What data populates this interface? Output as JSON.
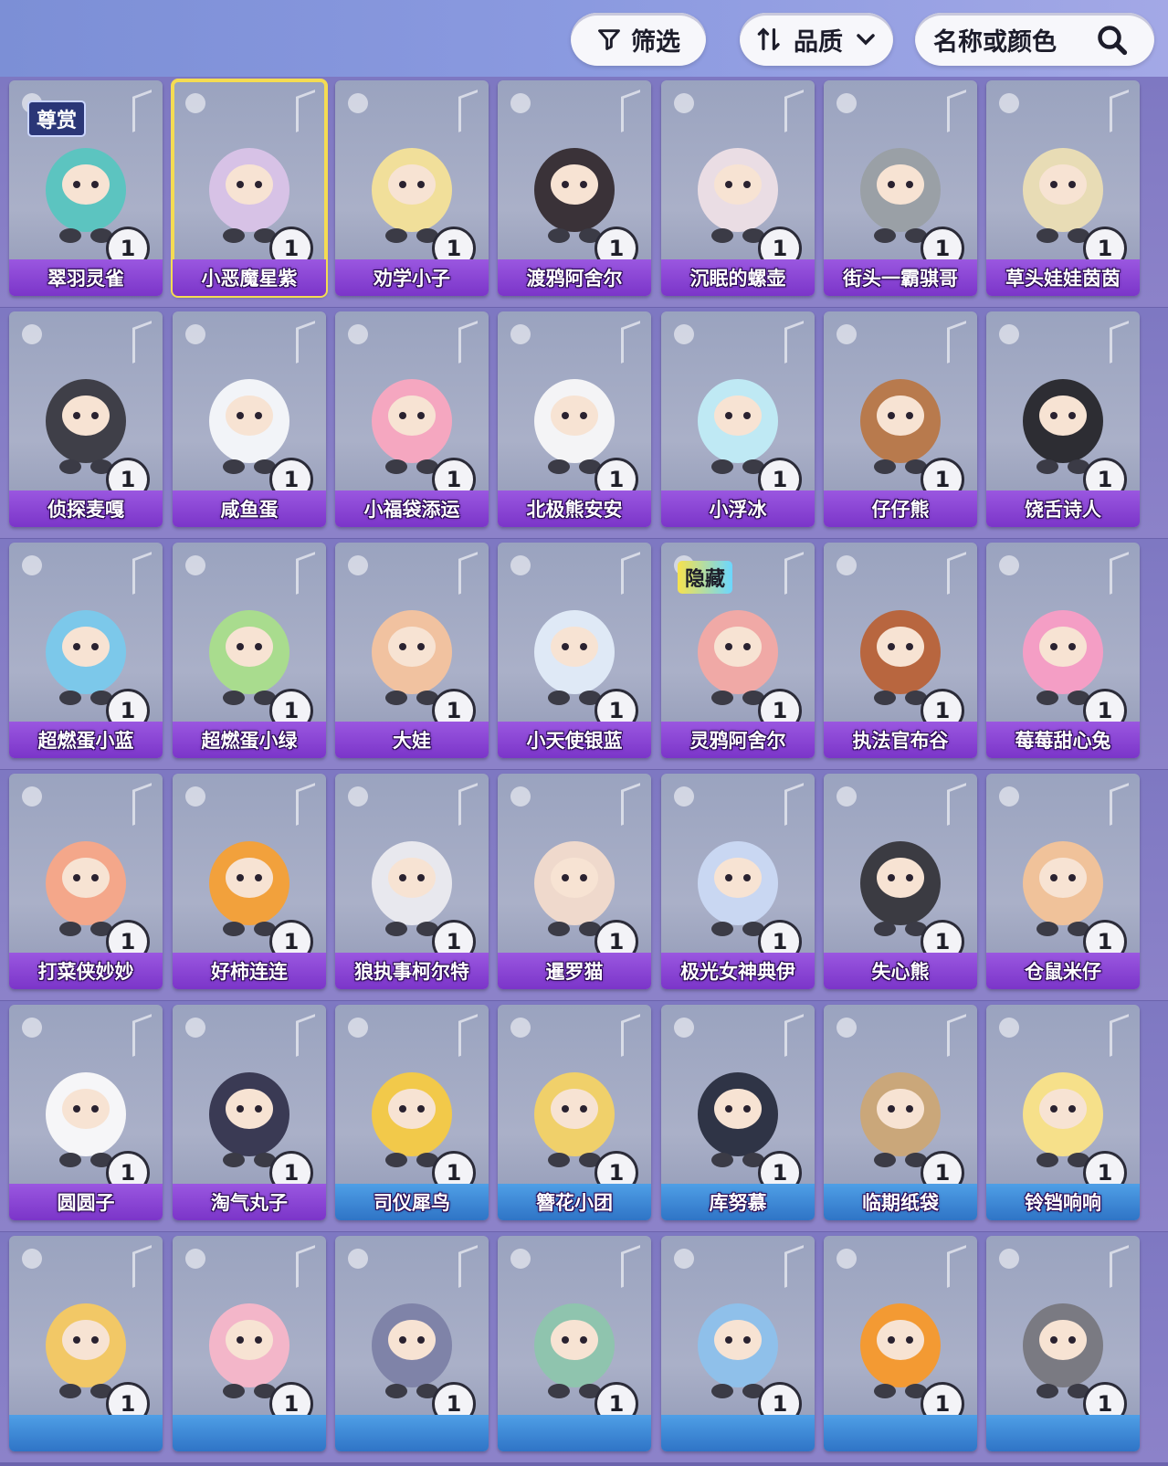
{
  "toolbar": {
    "filter_label": "筛选",
    "quality_label": "品质",
    "search_placeholder": "名称或颜色"
  },
  "colors": {
    "card_label_purple": "#8a45d6",
    "card_label_blue": "#3a86d6",
    "selected_border": "#f4dc52"
  },
  "rows": [
    [
      {
        "name": "翠羽灵雀",
        "count": "1",
        "tag": "尊赏",
        "label_style": "purple",
        "color": "#5cc4c0"
      },
      {
        "name": "小恶魔星紫",
        "count": "1",
        "tag": "",
        "label_style": "purple",
        "color": "#d7c2e6",
        "selected": true
      },
      {
        "name": "劝学小子",
        "count": "1",
        "tag": "",
        "label_style": "purple",
        "color": "#f1df9a"
      },
      {
        "name": "渡鸦阿舍尔",
        "count": "1",
        "tag": "",
        "label_style": "purple",
        "color": "#3a3238"
      },
      {
        "name": "沉眠的螺壶",
        "count": "1",
        "tag": "",
        "label_style": "purple",
        "color": "#eadde4"
      },
      {
        "name": "街头一霸骐哥",
        "count": "1",
        "tag": "",
        "label_style": "purple",
        "color": "#9aa0a6"
      },
      {
        "name": "草头娃娃茵茵",
        "count": "1",
        "tag": "",
        "label_style": "purple",
        "color": "#e8dcb5"
      }
    ],
    [
      {
        "name": "侦探麦嘎",
        "count": "1",
        "tag": "",
        "label_style": "purple",
        "color": "#3f3f48"
      },
      {
        "name": "咸鱼蛋",
        "count": "1",
        "tag": "",
        "label_style": "purple",
        "color": "#f2f4f8"
      },
      {
        "name": "小福袋添运",
        "count": "1",
        "tag": "",
        "label_style": "purple",
        "color": "#f5a7c0"
      },
      {
        "name": "北极熊安安",
        "count": "1",
        "tag": "",
        "label_style": "purple",
        "color": "#f4f4f6"
      },
      {
        "name": "小浮冰",
        "count": "1",
        "tag": "",
        "label_style": "purple",
        "color": "#bfe9f4"
      },
      {
        "name": "仔仔熊",
        "count": "1",
        "tag": "",
        "label_style": "purple",
        "color": "#b87a4d"
      },
      {
        "name": "饶舌诗人",
        "count": "1",
        "tag": "",
        "label_style": "purple",
        "color": "#2d2d33"
      }
    ],
    [
      {
        "name": "超燃蛋小蓝",
        "count": "1",
        "tag": "",
        "label_style": "purple",
        "color": "#7cc8ea"
      },
      {
        "name": "超燃蛋小绿",
        "count": "1",
        "tag": "",
        "label_style": "purple",
        "color": "#a9dc8e"
      },
      {
        "name": "大娃",
        "count": "1",
        "tag": "",
        "label_style": "purple",
        "color": "#f1c2a0"
      },
      {
        "name": "小天使银蓝",
        "count": "1",
        "tag": "",
        "label_style": "purple",
        "color": "#dfe9f6"
      },
      {
        "name": "灵鸦阿舍尔",
        "count": "1",
        "tag": "隐藏",
        "label_style": "purple",
        "color": "#f0a9a6"
      },
      {
        "name": "执法官布谷",
        "count": "1",
        "tag": "",
        "label_style": "purple",
        "color": "#b8663f"
      },
      {
        "name": "莓莓甜心兔",
        "count": "1",
        "tag": "",
        "label_style": "purple",
        "color": "#f49ec5"
      }
    ],
    [
      {
        "name": "打菜侠妙妙",
        "count": "1",
        "tag": "",
        "label_style": "purple",
        "color": "#f4a78a"
      },
      {
        "name": "好柿连连",
        "count": "1",
        "tag": "",
        "label_style": "purple",
        "color": "#f2a13c"
      },
      {
        "name": "狼执事柯尔特",
        "count": "1",
        "tag": "",
        "label_style": "purple",
        "color": "#e8e8ee"
      },
      {
        "name": "暹罗猫",
        "count": "1",
        "tag": "",
        "label_style": "purple",
        "color": "#efd9cc"
      },
      {
        "name": "极光女神典伊",
        "count": "1",
        "tag": "",
        "label_style": "purple",
        "color": "#c9d7f2"
      },
      {
        "name": "失心熊",
        "count": "1",
        "tag": "",
        "label_style": "purple",
        "color": "#3b3b42"
      },
      {
        "name": "仓鼠米仔",
        "count": "1",
        "tag": "",
        "label_style": "purple",
        "color": "#f0c29a"
      }
    ],
    [
      {
        "name": "圆圆子",
        "count": "1",
        "tag": "",
        "label_style": "purple",
        "color": "#f6f6f8"
      },
      {
        "name": "淘气丸子",
        "count": "1",
        "tag": "",
        "label_style": "purple",
        "color": "#3a3a54"
      },
      {
        "name": "司仪犀鸟",
        "count": "1",
        "tag": "",
        "label_style": "blue",
        "color": "#f2c94a"
      },
      {
        "name": "簪花小团",
        "count": "1",
        "tag": "",
        "label_style": "blue",
        "color": "#f0d06a"
      },
      {
        "name": "库努慕",
        "count": "1",
        "tag": "",
        "label_style": "blue",
        "color": "#2f3446"
      },
      {
        "name": "临期纸袋",
        "count": "1",
        "tag": "",
        "label_style": "blue",
        "color": "#caa77a"
      },
      {
        "name": "铃铛响响",
        "count": "1",
        "tag": "",
        "label_style": "blue",
        "color": "#f6e08a"
      }
    ],
    [
      {
        "name": "",
        "count": "1",
        "tag": "",
        "label_style": "blue",
        "color": "#f2c866"
      },
      {
        "name": "",
        "count": "1",
        "tag": "",
        "label_style": "blue",
        "color": "#f3b6c9"
      },
      {
        "name": "",
        "count": "1",
        "tag": "",
        "label_style": "blue",
        "color": "#7f83a8"
      },
      {
        "name": "",
        "count": "1",
        "tag": "",
        "label_style": "blue",
        "color": "#8fc4ae"
      },
      {
        "name": "",
        "count": "1",
        "tag": "",
        "label_style": "blue",
        "color": "#8fc0ea"
      },
      {
        "name": "",
        "count": "1",
        "tag": "",
        "label_style": "blue",
        "color": "#f39a33"
      },
      {
        "name": "",
        "count": "1",
        "tag": "",
        "label_style": "blue",
        "color": "#7a7a82"
      }
    ]
  ]
}
